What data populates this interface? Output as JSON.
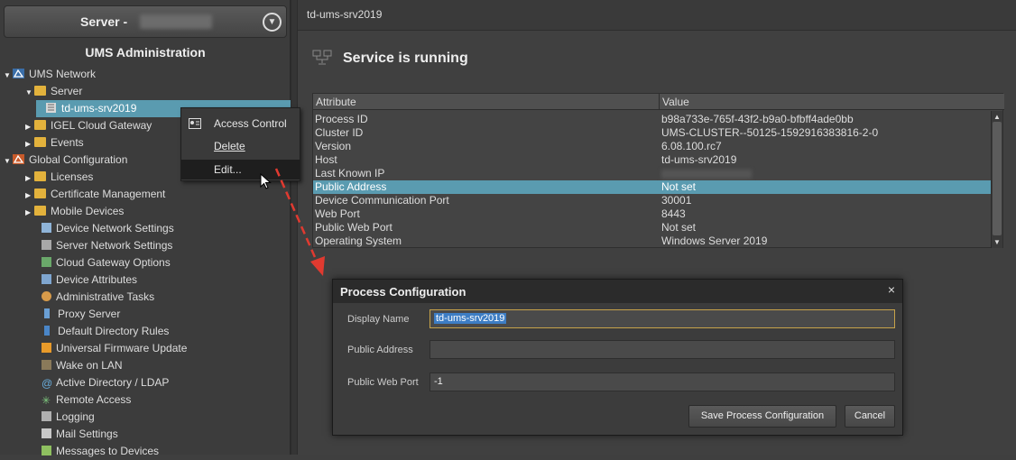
{
  "sidebar": {
    "server_label": "Server -",
    "title": "UMS Administration",
    "tree": [
      {
        "label": "UMS Network",
        "icon": "ums-network-icon"
      },
      {
        "label": "Server",
        "icon": "folder-icon"
      },
      {
        "label": "td-ums-srv2019",
        "icon": "server-icon"
      },
      {
        "label": "IGEL Cloud Gateway",
        "icon": "folder-icon"
      },
      {
        "label": "Events",
        "icon": "folder-icon"
      },
      {
        "label": "Global Configuration",
        "icon": "global-config-icon"
      },
      {
        "label": "Licenses",
        "icon": "folder-icon"
      },
      {
        "label": "Certificate Management",
        "icon": "folder-icon"
      },
      {
        "label": "Mobile Devices",
        "icon": "folder-icon"
      },
      {
        "label": "Device Network Settings",
        "icon": "device-network-icon"
      },
      {
        "label": "Server Network Settings",
        "icon": "server-network-icon"
      },
      {
        "label": "Cloud Gateway Options",
        "icon": "cloud-gateway-icon"
      },
      {
        "label": "Device Attributes",
        "icon": "device-attributes-icon"
      },
      {
        "label": "Administrative Tasks",
        "icon": "tasks-icon"
      },
      {
        "label": "Proxy Server",
        "icon": "proxy-icon"
      },
      {
        "label": "Default Directory Rules",
        "icon": "directory-rules-icon"
      },
      {
        "label": "Universal Firmware Update",
        "icon": "firmware-icon"
      },
      {
        "label": "Wake on LAN",
        "icon": "wake-icon"
      },
      {
        "label": "Active Directory / LDAP",
        "icon": "at-icon"
      },
      {
        "label": "Remote Access",
        "icon": "remote-access-icon"
      },
      {
        "label": "Logging",
        "icon": "logging-icon"
      },
      {
        "label": "Mail Settings",
        "icon": "mail-icon"
      },
      {
        "label": "Messages to Devices",
        "icon": "message-icon"
      }
    ]
  },
  "context_menu": {
    "items": [
      "Access Control",
      "Delete",
      "Edit..."
    ]
  },
  "main": {
    "tab": "td-ums-srv2019",
    "status": "Service is running",
    "table": {
      "headers": [
        "Attribute",
        "Value"
      ],
      "rows": [
        [
          "Process ID",
          "b98a733e-765f-43f2-b9a0-bfbff4ade0bb"
        ],
        [
          "Cluster ID",
          "UMS-CLUSTER--50125-1592916383816-2-0"
        ],
        [
          "Version",
          "6.08.100.rc7"
        ],
        [
          "Host",
          "td-ums-srv2019"
        ],
        [
          "Last Known IP",
          ""
        ],
        [
          "Public Address",
          "Not set"
        ],
        [
          "Device Communication Port",
          "30001"
        ],
        [
          "Web Port",
          "8443"
        ],
        [
          "Public Web Port",
          "Not set"
        ],
        [
          "Operating System",
          "Windows Server 2019"
        ]
      ]
    }
  },
  "dialog": {
    "title": "Process Configuration",
    "close": "×",
    "display_name_label": "Display Name",
    "display_name_value": "td-ums-srv2019",
    "public_address_label": "Public Address",
    "public_address_value": "",
    "public_web_port_label": "Public Web Port",
    "public_web_port_value": "-1",
    "save_label": "Save Process Configuration",
    "cancel_label": "Cancel"
  },
  "colors": {
    "selection": "#5a9bb0",
    "folder": "#e3b23c",
    "arrow": "#e03a30"
  }
}
